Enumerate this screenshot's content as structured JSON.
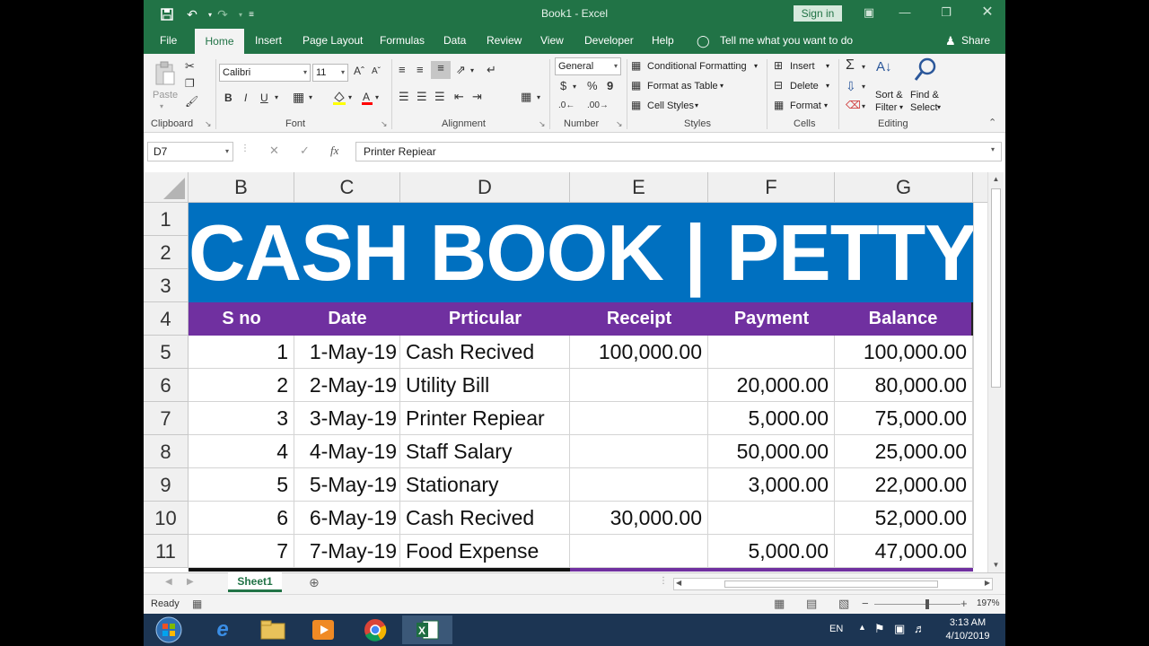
{
  "titlebar": {
    "title": "Book1  -  Excel",
    "signin": "Sign in",
    "save_icon": "save-icon",
    "undo_icon": "undo-icon",
    "redo_icon": "redo-icon"
  },
  "tabs": [
    "File",
    "Home",
    "Insert",
    "Page Layout",
    "Formulas",
    "Data",
    "Review",
    "View",
    "Developer",
    "Help"
  ],
  "tellme": "Tell me what you want to do",
  "share": "Share",
  "ribbon": {
    "clipboard": {
      "label": "Clipboard",
      "paste": "Paste"
    },
    "font": {
      "label": "Font",
      "name": "Calibri",
      "size": "11",
      "bold": "B",
      "italic": "I",
      "underline": "U"
    },
    "alignment": {
      "label": "Alignment"
    },
    "number": {
      "label": "Number",
      "format": "General",
      "currency": "$",
      "percent": "%",
      "comma": "9"
    },
    "styles": {
      "label": "Styles",
      "conditional": "Conditional Formatting",
      "format_table": "Format as Table",
      "cell_styles": "Cell Styles"
    },
    "cells": {
      "label": "Cells",
      "insert": "Insert",
      "delete": "Delete",
      "format": "Format"
    },
    "editing": {
      "label": "Editing",
      "sort": "Sort &",
      "filter": "Filter",
      "find": "Find &",
      "select": "Select"
    }
  },
  "formula_bar": {
    "name_box": "D7",
    "content": "Printer Repiear",
    "fx": "fx"
  },
  "columns": [
    "B",
    "C",
    "D",
    "E",
    "F",
    "G"
  ],
  "rows": [
    "1",
    "2",
    "3",
    "4",
    "5",
    "6",
    "7",
    "8",
    "9",
    "10",
    "11"
  ],
  "banner": "CASH BOOK | PETTY CASH",
  "table": {
    "headers": [
      "S no",
      "Date",
      "Prticular",
      "Receipt",
      "Payment",
      "Balance"
    ],
    "rows": [
      [
        "1",
        "1-May-19",
        "Cash Recived",
        "100,000.00",
        "",
        "100,000.00"
      ],
      [
        "2",
        "2-May-19",
        "Utility Bill",
        "",
        "20,000.00",
        "80,000.00"
      ],
      [
        "3",
        "3-May-19",
        "Printer Repiear",
        "",
        "5,000.00",
        "75,000.00"
      ],
      [
        "4",
        "4-May-19",
        "Staff Salary",
        "",
        "50,000.00",
        "25,000.00"
      ],
      [
        "5",
        "5-May-19",
        "Stationary",
        "",
        "3,000.00",
        "22,000.00"
      ],
      [
        "6",
        "6-May-19",
        "Cash Recived",
        "30,000.00",
        "",
        "52,000.00"
      ],
      [
        "7",
        "7-May-19",
        "Food Expense",
        "",
        "5,000.00",
        "47,000.00"
      ]
    ]
  },
  "sheet_tab": "Sheet1",
  "status": {
    "ready": "Ready",
    "zoom": "197%"
  },
  "taskbar": {
    "lang": "EN",
    "time": "3:13 AM",
    "date": "4/10/2019"
  },
  "colors": {
    "excel_green": "#217346",
    "banner_blue": "#0070c0",
    "header_purple": "#7030a0"
  }
}
